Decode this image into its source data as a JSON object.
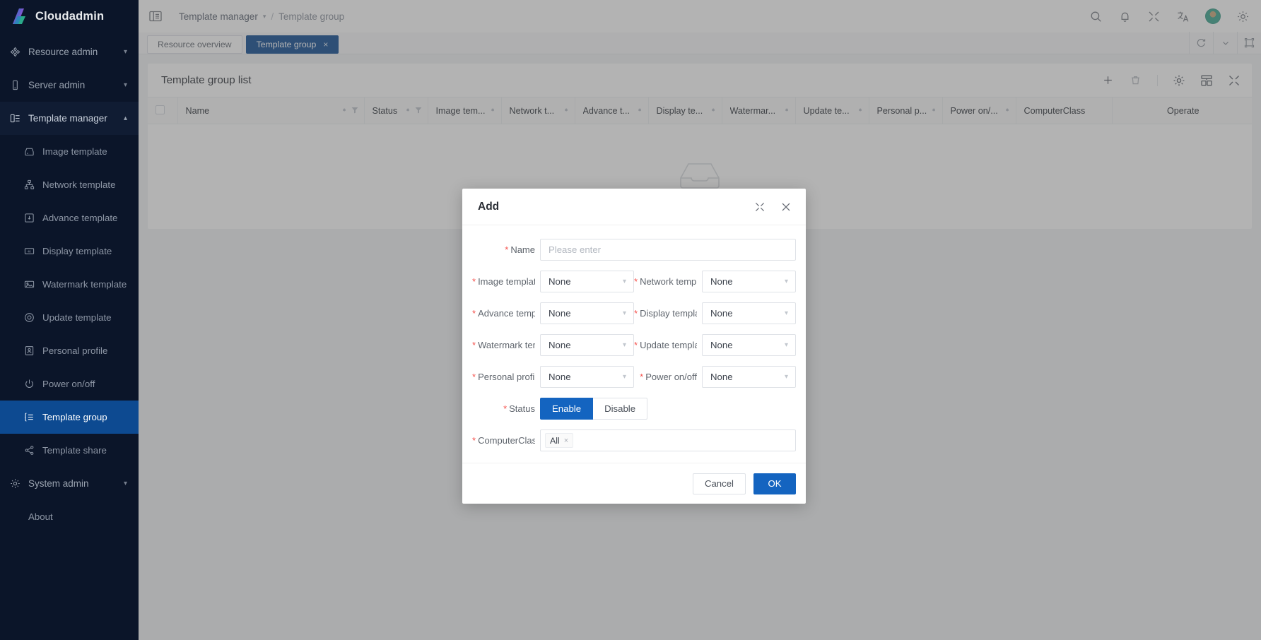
{
  "brand": {
    "name": "Cloudadmin"
  },
  "sidebar": {
    "groups": [
      {
        "label": "Resource admin",
        "icon": "resource-icon",
        "open": false
      },
      {
        "label": "Server admin",
        "icon": "server-icon",
        "open": false
      },
      {
        "label": "Template manager",
        "icon": "template-manager-icon",
        "open": true
      }
    ],
    "template_items": [
      {
        "label": "Image template",
        "icon": "image-template-icon",
        "active": false
      },
      {
        "label": "Network template",
        "icon": "network-template-icon",
        "active": false
      },
      {
        "label": "Advance template",
        "icon": "advance-template-icon",
        "active": false
      },
      {
        "label": "Display template",
        "icon": "display-template-icon",
        "active": false
      },
      {
        "label": "Watermark template",
        "icon": "watermark-template-icon",
        "active": false
      },
      {
        "label": "Update template",
        "icon": "update-template-icon",
        "active": false
      },
      {
        "label": "Personal profile",
        "icon": "personal-profile-icon",
        "active": false
      },
      {
        "label": "Power on/off",
        "icon": "power-icon",
        "active": false
      },
      {
        "label": "Template group",
        "icon": "template-group-icon",
        "active": true
      },
      {
        "label": "Template share",
        "icon": "share-icon",
        "active": false
      }
    ],
    "system_admin": {
      "label": "System admin",
      "icon": "gear-icon"
    },
    "about": {
      "label": "About"
    },
    "active_color": "#0d4a91",
    "background": "#0b1529"
  },
  "topbar": {
    "breadcrumb": {
      "parent": "Template manager",
      "separator": "/",
      "current": "Template group"
    },
    "icons": [
      "search-icon",
      "bell-icon",
      "compress-icon",
      "translate-icon",
      "avatar",
      "gear-icon"
    ]
  },
  "tabs": {
    "items": [
      {
        "label": "Resource overview",
        "active": false,
        "closable": false
      },
      {
        "label": "Template group",
        "active": true,
        "closable": true,
        "close": "×"
      }
    ],
    "tools": [
      "refresh-icon",
      "chevron-down-icon",
      "fullscreen-icon"
    ]
  },
  "list_card": {
    "title": "Template group list",
    "tools": [
      "add-icon",
      "delete-icon",
      "settings-icon",
      "column-layout-icon",
      "compress-icon"
    ],
    "add_symbol": "+",
    "columns": [
      {
        "key": "checkbox",
        "label": "",
        "sortable": false,
        "filterable": false
      },
      {
        "key": "name",
        "label": "Name",
        "sortable": true,
        "filterable": true
      },
      {
        "key": "status",
        "label": "Status",
        "sortable": true,
        "filterable": true
      },
      {
        "key": "image",
        "label": "Image tem...",
        "sortable": true,
        "filterable": false
      },
      {
        "key": "network",
        "label": "Network t...",
        "sortable": true,
        "filterable": false
      },
      {
        "key": "advance",
        "label": "Advance t...",
        "sortable": true,
        "filterable": false
      },
      {
        "key": "display",
        "label": "Display te...",
        "sortable": true,
        "filterable": false
      },
      {
        "key": "watermark",
        "label": "Watermar...",
        "sortable": true,
        "filterable": false
      },
      {
        "key": "update",
        "label": "Update te...",
        "sortable": true,
        "filterable": false
      },
      {
        "key": "personal",
        "label": "Personal p...",
        "sortable": true,
        "filterable": false
      },
      {
        "key": "power",
        "label": "Power on/...",
        "sortable": true,
        "filterable": false
      },
      {
        "key": "computerclass",
        "label": "ComputerClass",
        "sortable": false,
        "filterable": false
      },
      {
        "key": "operate",
        "label": "Operate",
        "sortable": false,
        "filterable": false
      }
    ],
    "rows": [],
    "empty_icon": "empty-inbox-icon"
  },
  "modal": {
    "title": "Add",
    "head_icons": [
      "expand-icon",
      "close-icon"
    ],
    "fields": [
      {
        "label": "Name",
        "required": true,
        "type": "input",
        "value": "",
        "placeholder": "Please enter"
      },
      {
        "label": "Image template",
        "required": true,
        "type": "select",
        "value": "None"
      },
      {
        "label": "Network template",
        "required": true,
        "type": "select",
        "value": "None"
      },
      {
        "label": "Advance template",
        "required": true,
        "type": "select",
        "value": "None"
      },
      {
        "label": "Display template",
        "required": true,
        "type": "select",
        "value": "None"
      },
      {
        "label": "Watermark template",
        "required": true,
        "type": "select",
        "value": "None"
      },
      {
        "label": "Update template",
        "required": true,
        "type": "select",
        "value": "None"
      },
      {
        "label": "Personal profile",
        "required": true,
        "type": "select",
        "value": "None"
      },
      {
        "label": "Power on/off",
        "required": true,
        "type": "select",
        "value": "None"
      },
      {
        "label": "Status",
        "required": true,
        "type": "segmented",
        "value": "Enable",
        "options": [
          "Enable",
          "Disable"
        ]
      },
      {
        "label": "ComputerClass",
        "required": true,
        "type": "tags",
        "tags": [
          "All"
        ],
        "tag_close": "×"
      }
    ],
    "required_mark": "*",
    "buttons": {
      "cancel": "Cancel",
      "ok": "OK"
    },
    "accent": "#1464c0"
  }
}
